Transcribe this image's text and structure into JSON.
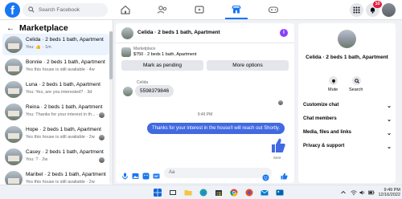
{
  "topbar": {
    "search_placeholder": "Search Facebook",
    "notification_count": "10"
  },
  "sidebar": {
    "title": "Marketplace",
    "conversations": [
      {
        "name": "Celida · 2 beds 1 bath, Apartment",
        "snippet": "You: 👍 · 1m",
        "active": true
      },
      {
        "name": "Bonnie · 2 beds 1 bath, Apartment",
        "snippet": "Yes this house is still available · 4w",
        "active": false
      },
      {
        "name": "Luna · 2 beds 1 bath, Apartment",
        "snippet": "You: Yes, are you interested? · 3d",
        "active": false
      },
      {
        "name": "Reina · 2 beds 1 bath, Apartment",
        "snippet": "You: Thanks for your interest in th... · 2w",
        "active": false
      },
      {
        "name": "Hope · 2 beds 1 bath, Apartment",
        "snippet": "Yes this house is still available · 2w",
        "active": false
      },
      {
        "name": "Casey · 2 beds 1 bath, Apartment",
        "snippet": "You: ? · 2w",
        "active": false
      },
      {
        "name": "Maribel · 2 beds 1 bath, Apartment",
        "snippet": "Yes this house is still available · 2w",
        "active": false
      }
    ]
  },
  "chat": {
    "title": "Celida · 2 beds 1 bath, Apartment",
    "marketplace_label": "Marketplace",
    "listing": "$750 · 2 beds 1 bath, Apartment",
    "mark_pending": "Mark as pending",
    "more_options": "More options",
    "sender": "Celida",
    "incoming": "5598379846",
    "timestamp": "9:49 PM",
    "outgoing": "Thanks for your interest in the house!I will reach out Shortly.",
    "sent_label": "Sent",
    "composer_placeholder": "Aa"
  },
  "info": {
    "title": "Celida · 2 beds 1 bath, Apartment",
    "mute": "Mute",
    "search": "Search",
    "rows": [
      "Customize chat",
      "Chat members",
      "Media, files and links",
      "Privacy & support"
    ]
  },
  "taskbar": {
    "time": "9:49 PM",
    "date": "12/16/2022"
  },
  "colors": {
    "brand": "#1877f2",
    "outgoing": "#4169e1",
    "accent": "#8a3ffc"
  }
}
